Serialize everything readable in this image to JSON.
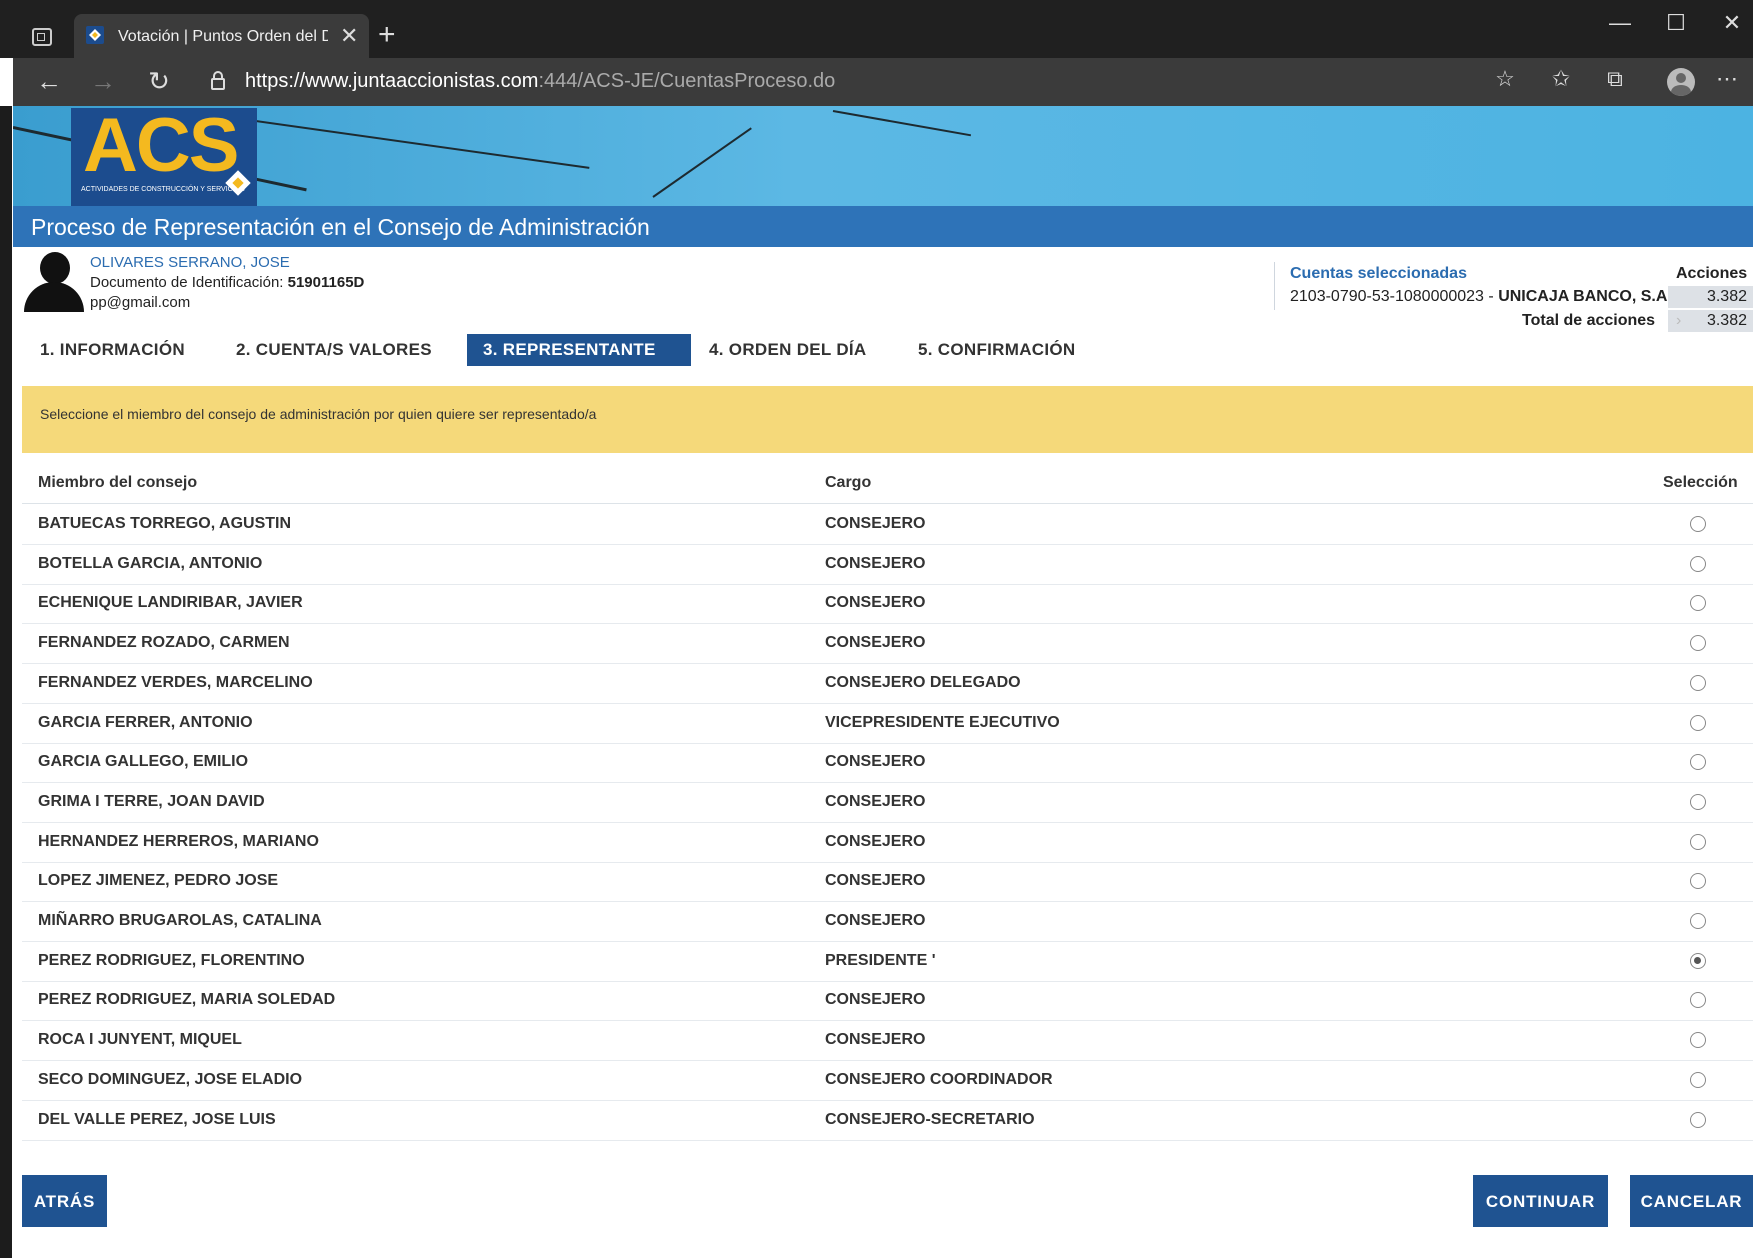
{
  "browser": {
    "tab_title": "Votación | Puntos Orden del Día",
    "url_main": "https://www.juntaaccionistas.com",
    "url_rest": ":444/ACS-JE/CuentasProceso.do"
  },
  "banner": {
    "logo_text": "ACS",
    "logo_subtitle": "ACTIVIDADES DE CONSTRUCCIÓN Y SERVICIOS",
    "page_title": "Proceso de Representación en el Consejo de Administración"
  },
  "user": {
    "name": "OLIVARES SERRANO, JOSE",
    "doc_label": "Documento de Identificación:",
    "doc_value": "51901165D",
    "email": "pp@gmail.com"
  },
  "accounts": {
    "title": "Cuentas seleccionadas",
    "shares_header": "Acciones",
    "account_number": "2103-0790-53-1080000023 -",
    "bank": "UNICAJA BANCO, S.A.",
    "account_shares": "3.382",
    "total_label": "Total de acciones",
    "total_value": "3.382"
  },
  "steps": [
    {
      "label": "1. INFORMACIÓN"
    },
    {
      "label": "2. CUENTA/S VALORES"
    },
    {
      "label": "3. REPRESENTANTE"
    },
    {
      "label": "4. ORDEN DEL DÍA"
    },
    {
      "label": "5. CONFIRMACIÓN"
    }
  ],
  "notice": "Seleccione el miembro del consejo de administración por quien quiere ser representado/a",
  "table": {
    "headers": {
      "member": "Miembro del consejo",
      "position": "Cargo",
      "selection": "Selección"
    },
    "rows": [
      {
        "name": "BATUECAS TORREGO, AGUSTIN",
        "cargo": "CONSEJERO",
        "selected": false
      },
      {
        "name": "BOTELLA GARCIA, ANTONIO",
        "cargo": "CONSEJERO",
        "selected": false
      },
      {
        "name": "ECHENIQUE LANDIRIBAR, JAVIER",
        "cargo": "CONSEJERO",
        "selected": false
      },
      {
        "name": "FERNANDEZ ROZADO, CARMEN",
        "cargo": "CONSEJERO",
        "selected": false
      },
      {
        "name": "FERNANDEZ VERDES, MARCELINO",
        "cargo": "CONSEJERO DELEGADO",
        "selected": false
      },
      {
        "name": "GARCIA FERRER, ANTONIO",
        "cargo": "VICEPRESIDENTE EJECUTIVO",
        "selected": false
      },
      {
        "name": "GARCIA GALLEGO, EMILIO",
        "cargo": "CONSEJERO",
        "selected": false
      },
      {
        "name": "GRIMA I TERRE, JOAN DAVID",
        "cargo": "CONSEJERO",
        "selected": false
      },
      {
        "name": "HERNANDEZ HERREROS, MARIANO",
        "cargo": "CONSEJERO",
        "selected": false
      },
      {
        "name": "LOPEZ JIMENEZ, PEDRO JOSE",
        "cargo": "CONSEJERO",
        "selected": false
      },
      {
        "name": "MIÑARRO BRUGAROLAS, CATALINA",
        "cargo": "CONSEJERO",
        "selected": false
      },
      {
        "name": "PEREZ RODRIGUEZ, FLORENTINO",
        "cargo": "PRESIDENTE '",
        "selected": true
      },
      {
        "name": "PEREZ RODRIGUEZ, MARIA SOLEDAD",
        "cargo": "CONSEJERO",
        "selected": false
      },
      {
        "name": "ROCA I JUNYENT, MIQUEL",
        "cargo": "CONSEJERO",
        "selected": false
      },
      {
        "name": "SECO DOMINGUEZ, JOSE ELADIO",
        "cargo": "CONSEJERO COORDINADOR",
        "selected": false
      },
      {
        "name": "DEL VALLE PEREZ, JOSE LUIS",
        "cargo": "CONSEJERO-SECRETARIO",
        "selected": false
      }
    ]
  },
  "buttons": {
    "back": "ATRÁS",
    "continue": "CONTINUAR",
    "cancel": "CANCELAR"
  },
  "colors": {
    "primary": "#1f5391",
    "title_bar": "#2e73b8",
    "notice_bg": "#f5d97a",
    "logo_yellow": "#f4b91f"
  }
}
